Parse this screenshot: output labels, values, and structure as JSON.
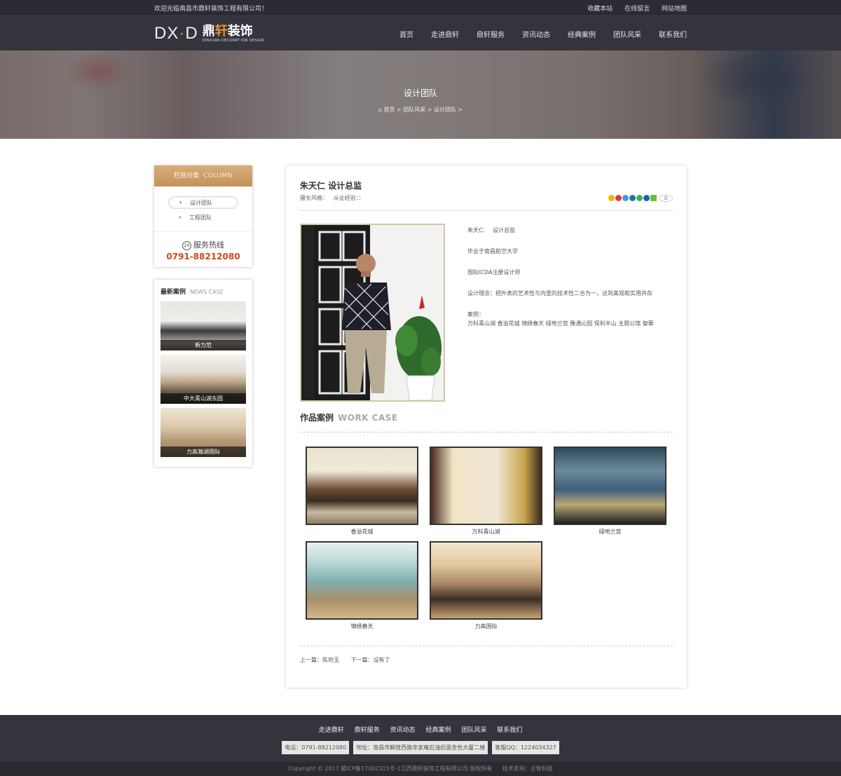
{
  "topbar": {
    "welcome": "欢迎光临南昌市鼎轩装饰工程有限公司！",
    "links": [
      "收藏本站",
      "在线留言",
      "网站地图"
    ]
  },
  "logo": {
    "dx": "DX",
    "dot": "·",
    "d": "D",
    "cn_a": "鼎",
    "cn_b": "轩",
    "cn_c": "装饰",
    "en": "DINXUAN DECORAT ION DESIGN"
  },
  "nav": [
    "首页",
    "走进鼎轩",
    "鼎轩服务",
    "资讯动态",
    "经典案例",
    "团队风采",
    "联系我们"
  ],
  "banner": {
    "title": "设计团队",
    "crumb": [
      "首页",
      "团队风采",
      "设计团队"
    ]
  },
  "sidebar": {
    "column_title": "栏目分类",
    "column_en": "COLUMN",
    "items": [
      "设计团队",
      "工程团队"
    ],
    "hotline_label": "服务热线",
    "hotline_icon": "24",
    "hotline_number": "0791-88212080",
    "news_title": "最新案例",
    "news_en": "NEWS CASE",
    "news": [
      "新力范",
      "中大青山湖东园",
      "力高瀚湖国际"
    ]
  },
  "article": {
    "title": "朱天仁  设计总监",
    "meta_style": "擅长风格：",
    "meta_exp": "从业经验：：",
    "share_count": "0",
    "info": {
      "name": "朱天仁",
      "role": "设计总监",
      "school": "毕业于南昌航空大学",
      "cert": "国际ICDA注册设计师",
      "philosophy": "设计理念：把外表的艺术性与内里的技术性二合为一，达到美观和实用共存",
      "cases_label": "案例：",
      "cases": "万科青山湖  香溢花城  锦绣春天  绿地兰宫  豫通沁园 保利半山 主题公馆 御華"
    },
    "work_title": "作品案例",
    "work_en": "WORK CASE",
    "works": [
      "香溢花城",
      "万科青山湖",
      "绿地兰宫",
      "锦绣春天",
      "力高国际"
    ],
    "prev": "上一篇：陈劝玉",
    "next": "下一篇：没有了"
  },
  "footer": {
    "nav": [
      "走进鼎轩",
      "鼎轩服务",
      "资讯动态",
      "经典案例",
      "团队风采",
      "联系我们"
    ],
    "phone": "电话：0791-88212080",
    "address": "地址：南昌市解放西路幸家庵石油后面金色大厦二楼",
    "qq": "客服QQ：1224034327",
    "copyright": "Copyright © 2017 赣ICP备17002315号-1江西鼎轩装饰工程有限公司 版权所有",
    "support": "技术支持：企智科技"
  },
  "colors": {
    "accent": "#c4925c",
    "hotline": "#d2451a",
    "dark": "#33343c"
  }
}
